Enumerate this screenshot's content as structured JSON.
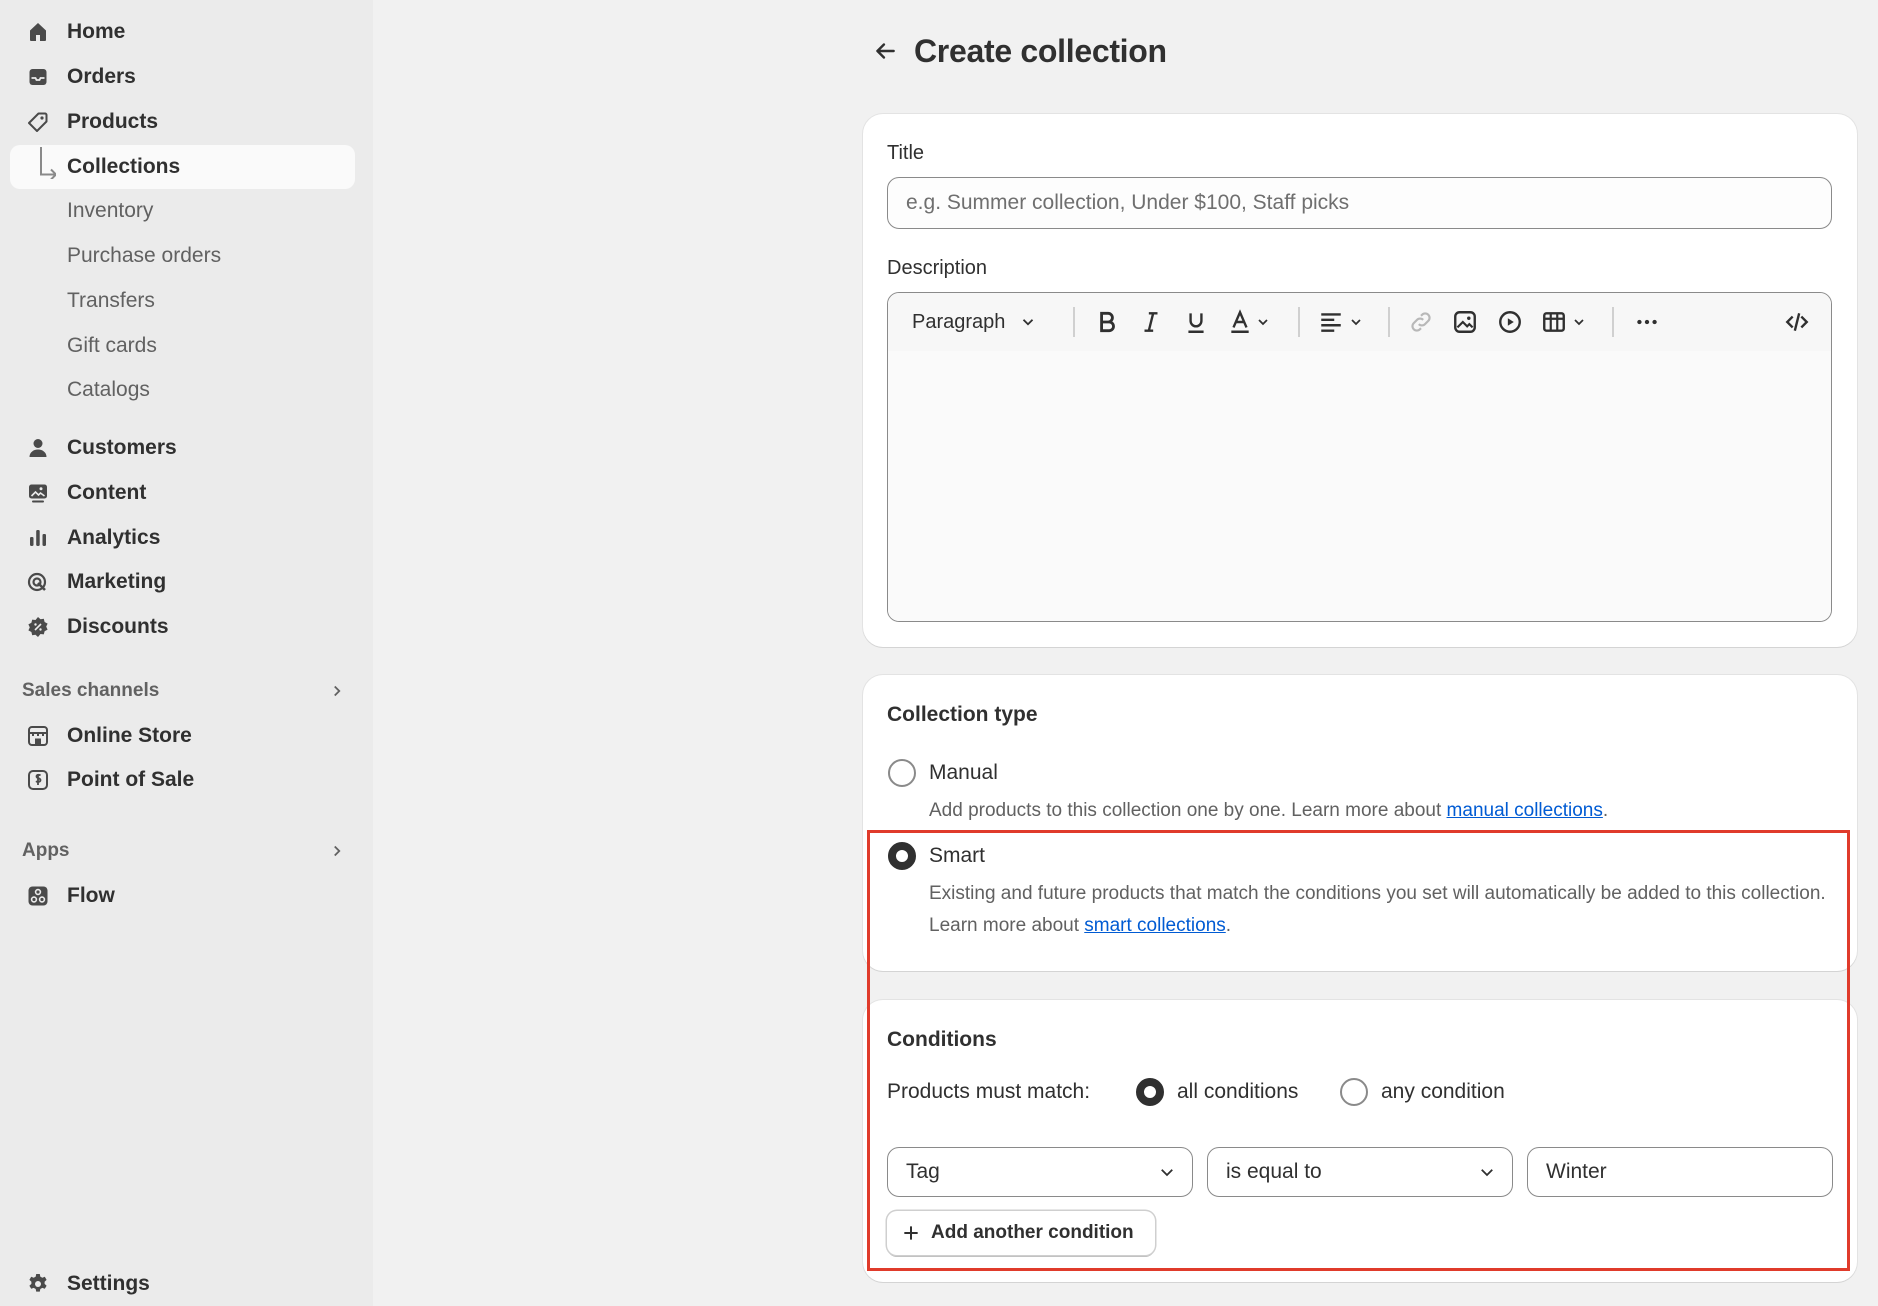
{
  "sidebar": {
    "items": [
      {
        "label": "Home",
        "icon": "home-icon"
      },
      {
        "label": "Orders",
        "icon": "orders-inbox-icon"
      },
      {
        "label": "Products",
        "icon": "tag-icon"
      },
      {
        "label": "Collections",
        "icon": "sub-arrow-icon"
      },
      {
        "label": "Inventory"
      },
      {
        "label": "Purchase orders"
      },
      {
        "label": "Transfers"
      },
      {
        "label": "Gift cards"
      },
      {
        "label": "Catalogs"
      },
      {
        "label": "Customers",
        "icon": "person-icon"
      },
      {
        "label": "Content",
        "icon": "image-content-icon"
      },
      {
        "label": "Analytics",
        "icon": "bar-chart-icon"
      },
      {
        "label": "Marketing",
        "icon": "target-icon"
      },
      {
        "label": "Discounts",
        "icon": "discount-badge-icon"
      }
    ],
    "sales_channels": {
      "title": "Sales channels",
      "items": [
        {
          "label": "Online Store",
          "icon": "store-icon"
        },
        {
          "label": "Point of Sale",
          "icon": "pos-icon"
        }
      ]
    },
    "apps": {
      "title": "Apps",
      "items": [
        {
          "label": "Flow",
          "icon": "flow-icon"
        }
      ]
    },
    "settings": {
      "label": "Settings",
      "icon": "gear-icon"
    }
  },
  "header": {
    "title": "Create collection"
  },
  "form": {
    "title_label": "Title",
    "title_placeholder": "e.g. Summer collection, Under $100, Staff picks",
    "description_label": "Description",
    "toolbar": {
      "paragraph": "Paragraph"
    }
  },
  "collection_type": {
    "title": "Collection type",
    "manual_label": "Manual",
    "manual_help": "Add products to this collection one by one. Learn more about ",
    "manual_link": "manual collections",
    "smart_label": "Smart",
    "smart_help": "Existing and future products that match the conditions you set will automatically be added to this collection. Learn more about ",
    "smart_link": "smart collections",
    "selected": "Smart"
  },
  "conditions": {
    "title": "Conditions",
    "match_label": "Products must match:",
    "all_label": "all conditions",
    "any_label": "any condition",
    "selected_match": "all conditions",
    "rule": {
      "field": "Tag",
      "operator": "is equal to",
      "value": "Winter"
    },
    "add_button": "Add another condition"
  },
  "colors": {
    "link": "#005bd3",
    "highlight": "#e03b2b"
  }
}
